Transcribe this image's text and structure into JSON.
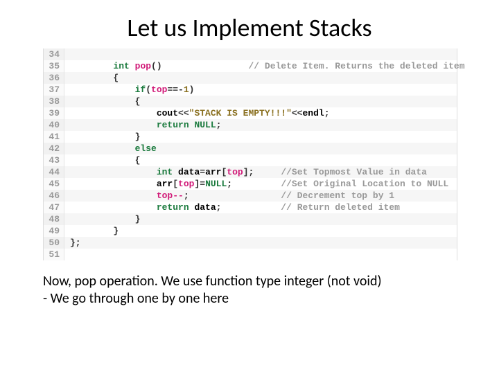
{
  "title": "Let us Implement Stacks",
  "code_lines": [
    {
      "n": 34,
      "segments": []
    },
    {
      "n": 35,
      "segments": [
        {
          "t": "        ",
          "c": ""
        },
        {
          "t": "int",
          "c": "kw-type"
        },
        {
          "t": " ",
          "c": ""
        },
        {
          "t": "pop",
          "c": "fn-name"
        },
        {
          "t": "()",
          "c": "punct"
        },
        {
          "t": "                ",
          "c": ""
        },
        {
          "t": "// Delete Item. Returns the deleted item",
          "c": "comment"
        }
      ]
    },
    {
      "n": 36,
      "segments": [
        {
          "t": "        {",
          "c": "punct"
        }
      ]
    },
    {
      "n": 37,
      "segments": [
        {
          "t": "            ",
          "c": ""
        },
        {
          "t": "if",
          "c": "kw-flow"
        },
        {
          "t": "(",
          "c": "punct"
        },
        {
          "t": "top",
          "c": "var-top"
        },
        {
          "t": "==-",
          "c": "op"
        },
        {
          "t": "1",
          "c": "num"
        },
        {
          "t": ")",
          "c": "punct"
        }
      ]
    },
    {
      "n": 38,
      "segments": [
        {
          "t": "            {",
          "c": "punct"
        }
      ]
    },
    {
      "n": 39,
      "segments": [
        {
          "t": "                cout",
          "c": ""
        },
        {
          "t": "<<",
          "c": "op"
        },
        {
          "t": "\"STACK IS EMPTY!!!\"",
          "c": "str"
        },
        {
          "t": "<<",
          "c": "op"
        },
        {
          "t": "endl",
          "c": ""
        },
        {
          "t": ";",
          "c": "punct"
        }
      ]
    },
    {
      "n": 40,
      "segments": [
        {
          "t": "                ",
          "c": ""
        },
        {
          "t": "return",
          "c": "kw-flow"
        },
        {
          "t": " ",
          "c": ""
        },
        {
          "t": "NULL",
          "c": "null-kw"
        },
        {
          "t": ";",
          "c": "punct"
        }
      ]
    },
    {
      "n": 41,
      "segments": [
        {
          "t": "            }",
          "c": "punct"
        }
      ]
    },
    {
      "n": 42,
      "segments": [
        {
          "t": "            ",
          "c": ""
        },
        {
          "t": "else",
          "c": "kw-flow"
        }
      ]
    },
    {
      "n": 43,
      "segments": [
        {
          "t": "            {",
          "c": "punct"
        }
      ]
    },
    {
      "n": 44,
      "segments": [
        {
          "t": "                ",
          "c": ""
        },
        {
          "t": "int",
          "c": "kw-type"
        },
        {
          "t": " data",
          "c": ""
        },
        {
          "t": "=",
          "c": "op"
        },
        {
          "t": "arr",
          "c": ""
        },
        {
          "t": "[",
          "c": "punct"
        },
        {
          "t": "top",
          "c": "var-top"
        },
        {
          "t": "];",
          "c": "punct"
        },
        {
          "t": "     ",
          "c": ""
        },
        {
          "t": "//Set Topmost Value in data",
          "c": "comment"
        }
      ]
    },
    {
      "n": 45,
      "segments": [
        {
          "t": "                arr",
          "c": ""
        },
        {
          "t": "[",
          "c": "punct"
        },
        {
          "t": "top",
          "c": "var-top"
        },
        {
          "t": "]=",
          "c": "punct"
        },
        {
          "t": "NULL",
          "c": "null-kw"
        },
        {
          "t": ";",
          "c": "punct"
        },
        {
          "t": "         ",
          "c": ""
        },
        {
          "t": "//Set Original Location to NULL",
          "c": "comment"
        }
      ]
    },
    {
      "n": 46,
      "segments": [
        {
          "t": "                ",
          "c": ""
        },
        {
          "t": "top",
          "c": "var-top"
        },
        {
          "t": "--",
          "c": "op-minus"
        },
        {
          "t": ";",
          "c": "punct"
        },
        {
          "t": "                 ",
          "c": ""
        },
        {
          "t": "// Decrement top by 1",
          "c": "comment"
        }
      ]
    },
    {
      "n": 47,
      "segments": [
        {
          "t": "                ",
          "c": ""
        },
        {
          "t": "return",
          "c": "kw-flow"
        },
        {
          "t": " data",
          "c": ""
        },
        {
          "t": ";",
          "c": "punct"
        },
        {
          "t": "           ",
          "c": ""
        },
        {
          "t": "// Return deleted item",
          "c": "comment"
        }
      ]
    },
    {
      "n": 48,
      "segments": [
        {
          "t": "            }",
          "c": "punct"
        }
      ]
    },
    {
      "n": 49,
      "segments": [
        {
          "t": "        }",
          "c": "punct"
        }
      ]
    },
    {
      "n": 50,
      "segments": [
        {
          "t": "};",
          "c": "punct"
        }
      ]
    },
    {
      "n": 51,
      "segments": []
    }
  ],
  "caption_line1": "Now, pop operation. We use function type integer (not void)",
  "caption_line2": "- We go through one by one here"
}
